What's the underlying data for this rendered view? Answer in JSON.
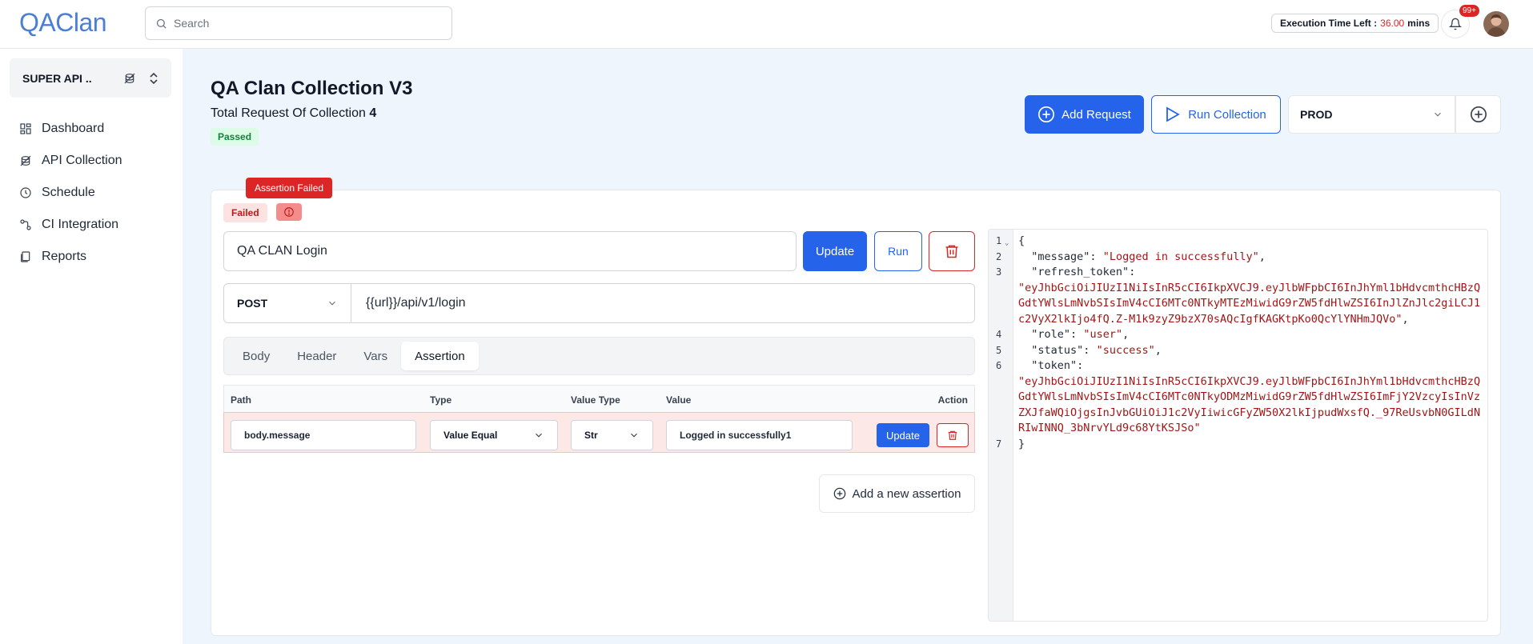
{
  "app": {
    "logo": "QAClan"
  },
  "header": {
    "search_placeholder": "Search",
    "exec_label": "Execution Time Left :",
    "exec_value": "36.00",
    "exec_unit": "mins",
    "notif_count": "99+"
  },
  "sidebar": {
    "workspace": "SUPER API ..",
    "items": [
      {
        "label": "Dashboard",
        "icon": "dashboard-icon"
      },
      {
        "label": "API Collection",
        "icon": "api-icon"
      },
      {
        "label": "Schedule",
        "icon": "clock-icon"
      },
      {
        "label": "CI Integration",
        "icon": "integration-icon"
      },
      {
        "label": "Reports",
        "icon": "report-icon"
      }
    ]
  },
  "collection": {
    "title": "QA Clan Collection V3",
    "total_label": "Total Request Of Collection",
    "total_value": "4",
    "status": "Passed"
  },
  "toolbar": {
    "add_request": "Add Request",
    "run_collection": "Run Collection",
    "environment": "PROD"
  },
  "request": {
    "tooltip": "Assertion Failed",
    "status": "Failed",
    "name": "QA CLAN Login",
    "update_label": "Update",
    "run_label": "Run",
    "method": "POST",
    "url": "{{url}}/api/v1/login",
    "tabs": [
      "Body",
      "Header",
      "Vars",
      "Assertion"
    ],
    "active_tab": "Assertion"
  },
  "assertions": {
    "headers": {
      "path": "Path",
      "type": "Type",
      "value_type": "Value Type",
      "value": "Value",
      "action": "Action"
    },
    "rows": [
      {
        "path": "body.message",
        "type": "Value Equal",
        "value_type": "Str",
        "value": "Logged in successfully1",
        "update_label": "Update"
      }
    ],
    "add_label": "Add a new assertion"
  },
  "response": {
    "line_numbers": [
      "1",
      "2",
      "3",
      "4",
      "5",
      "6",
      "7"
    ],
    "open_brace": "{",
    "close_brace": "}",
    "message_key": "\"message\"",
    "message_val": "\"Logged in successfully\"",
    "refresh_key": "\"refresh_token\"",
    "refresh_val": "\"eyJhbGciOiJIUzI1NiIsInR5cCI6IkpXVCJ9.eyJlbWFpbCI6InJhYml1bHdvcmthcHBzQGdtYWlsLmNvbSIsImV4cCI6MTc0NTkyMTEzMiwidG9rZW5fdHlwZSI6InJlZnJlc2giLCJ1c2VyX2lkIjo4fQ.Z-M1k9zyZ9bzX70sAQcIgfKAGKtpKo0QcYlYNHmJQVo\"",
    "role_key": "\"role\"",
    "role_val": "\"user\"",
    "status_key": "\"status\"",
    "status_val": "\"success\"",
    "token_key": "\"token\"",
    "token_val": "\"eyJhbGciOiJIUzI1NiIsInR5cCI6IkpXVCJ9.eyJlbWFpbCI6InJhYml1bHdvcmthcHBzQGdtYWlsLmNvbSIsImV4cCI6MTc0NTkyODMzMiwidG9rZW5fdHlwZSI6ImFjY2VzcyIsInVzZXJfaWQiOjgsInJvbGUiOiJ1c2VyIiwicGFyZW50X2lkIjpudWxsfQ._97ReUsvbN0GILdNRIwINNQ_3bNrvYLd9c68YtKSJSo\""
  },
  "colors": {
    "primary": "#2563eb",
    "danger": "#dc2626",
    "success_bg": "#dcfce7",
    "main_bg": "#eef5fc"
  }
}
